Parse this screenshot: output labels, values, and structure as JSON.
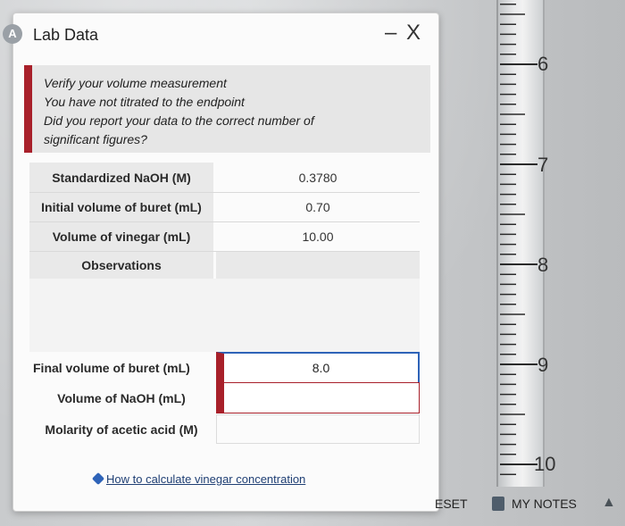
{
  "dialog": {
    "title": "Lab Data",
    "window_controls": "– X",
    "app_icon_glyph": "A"
  },
  "messages": [
    "Verify your volume measurement",
    "You have not titrated to the endpoint",
    "Did you report your data to the correct number of",
    "significant figures?"
  ],
  "table": {
    "rows": [
      {
        "label": "Standardized NaOH (M)",
        "value": "0.3780"
      },
      {
        "label": "Initial volume of buret (mL)",
        "value": "0.70"
      },
      {
        "label": "Volume of vinegar (mL)",
        "value": "10.00"
      },
      {
        "label": "Observations",
        "value": ""
      }
    ],
    "inputs": [
      {
        "label": "Final volume of buret (mL)",
        "value": "8.0"
      },
      {
        "label": "Volume of NaOH (mL)",
        "value": ""
      },
      {
        "label": "Molarity of acetic acid (M)",
        "value": ""
      }
    ]
  },
  "help_link": "How to calculate vinegar concentration",
  "toolbar": {
    "reset": "ESET",
    "my_notes": "MY NOTES"
  },
  "buret": {
    "labels": [
      "6",
      "7",
      "8",
      "9",
      "10"
    ]
  },
  "colors": {
    "error_accent": "#a8202a",
    "focus_border": "#2e63b8",
    "link": "#1f3f74"
  },
  "icons": {
    "app": "flask-icon",
    "help": "diamond-icon",
    "notes": "notes-icon",
    "corner": "flask-icon"
  }
}
